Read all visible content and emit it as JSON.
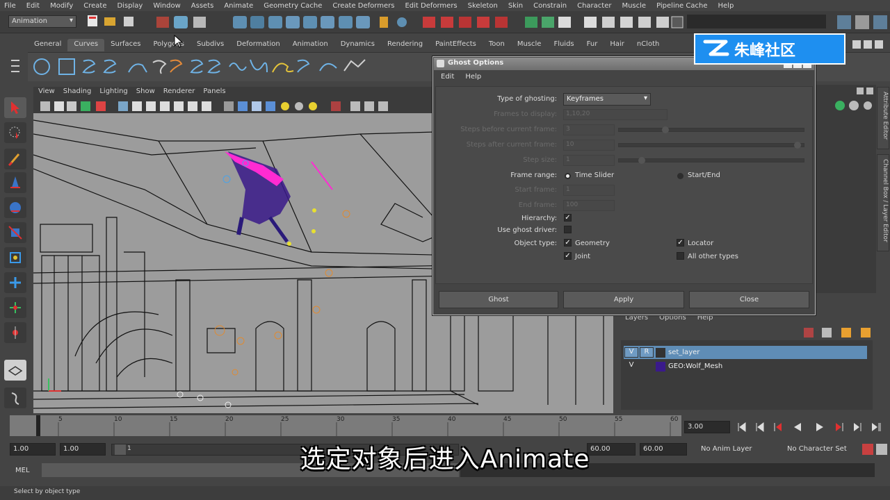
{
  "menubar": [
    "File",
    "Edit",
    "Modify",
    "Create",
    "Display",
    "Window",
    "Assets",
    "Animate",
    "Geometry Cache",
    "Create Deformers",
    "Edit Deformers",
    "Skeleton",
    "Skin",
    "Constrain",
    "Character",
    "Muscle",
    "Pipeline Cache",
    "Help"
  ],
  "mode_menu": "Animation",
  "shelf_tabs": [
    "General",
    "Curves",
    "Surfaces",
    "Polygons",
    "Subdivs",
    "Deformation",
    "Animation",
    "Dynamics",
    "Rendering",
    "PaintEffects",
    "Toon",
    "Muscle",
    "Fluids",
    "Fur",
    "Hair",
    "nCloth"
  ],
  "shelf_active": "Curves",
  "viewport_menu": [
    "View",
    "Shading",
    "Lighting",
    "Show",
    "Renderer",
    "Panels"
  ],
  "ghost_dialog": {
    "title": "Ghost Options",
    "menu": [
      "Edit",
      "Help"
    ],
    "type_label": "Type of ghosting:",
    "type_value": "Keyframes",
    "frames_display_label": "Frames to display:",
    "frames_display_value": "1,10,20",
    "steps_before_label": "Steps before current frame:",
    "steps_before_value": "3",
    "steps_after_label": "Steps after current frame:",
    "steps_after_value": "10",
    "step_size_label": "Step size:",
    "step_size_value": "1",
    "frame_range_label": "Frame range:",
    "opt_time_slider": "Time Slider",
    "opt_start_end": "Start/End",
    "start_frame_label": "Start frame:",
    "start_frame_value": "1",
    "end_frame_label": "End frame:",
    "end_frame_value": "100",
    "hierarchy_label": "Hierarchy:",
    "ghost_driver_label": "Use ghost driver:",
    "object_type_label": "Object type:",
    "opt_geometry": "Geometry",
    "opt_locator": "Locator",
    "opt_joint": "Joint",
    "opt_all_other": "All other types",
    "btn_ghost": "Ghost",
    "btn_apply": "Apply",
    "btn_close": "Close"
  },
  "layers": {
    "menu": [
      "Layers",
      "Options",
      "Help"
    ],
    "rows": [
      {
        "vis": "V",
        "ref": "R",
        "name": "set_layer",
        "selected": true
      },
      {
        "vis": "V",
        "ref": "",
        "name": "GEO:Wolf_Mesh",
        "selected": false
      }
    ]
  },
  "side_tabs": [
    "Attribute Editor",
    "Channel Box / Layer Editor"
  ],
  "timeline": {
    "ticks": [
      "5",
      "10",
      "15",
      "20",
      "25",
      "30",
      "35",
      "40",
      "45",
      "50",
      "55",
      "60"
    ],
    "current_marker": "3",
    "current_time": "3.00"
  },
  "range": {
    "start": "1.00",
    "start2": "1.00",
    "slider_value": "1",
    "end_a": "60.00",
    "end_b": "60.00",
    "anim_layer": "No Anim Layer",
    "char_set": "No Character Set"
  },
  "cmdline_label": "MEL",
  "help_line": "Select by object type",
  "watermark": "朱峰社区",
  "subtitle": "选定对象后进入Animate",
  "colors": {
    "accent_selected": "#5f8db6",
    "watermark_bg": "#1e8ff0",
    "wolf_magenta": "#ff2bd2",
    "wolf_purple": "#3a1a8a"
  }
}
